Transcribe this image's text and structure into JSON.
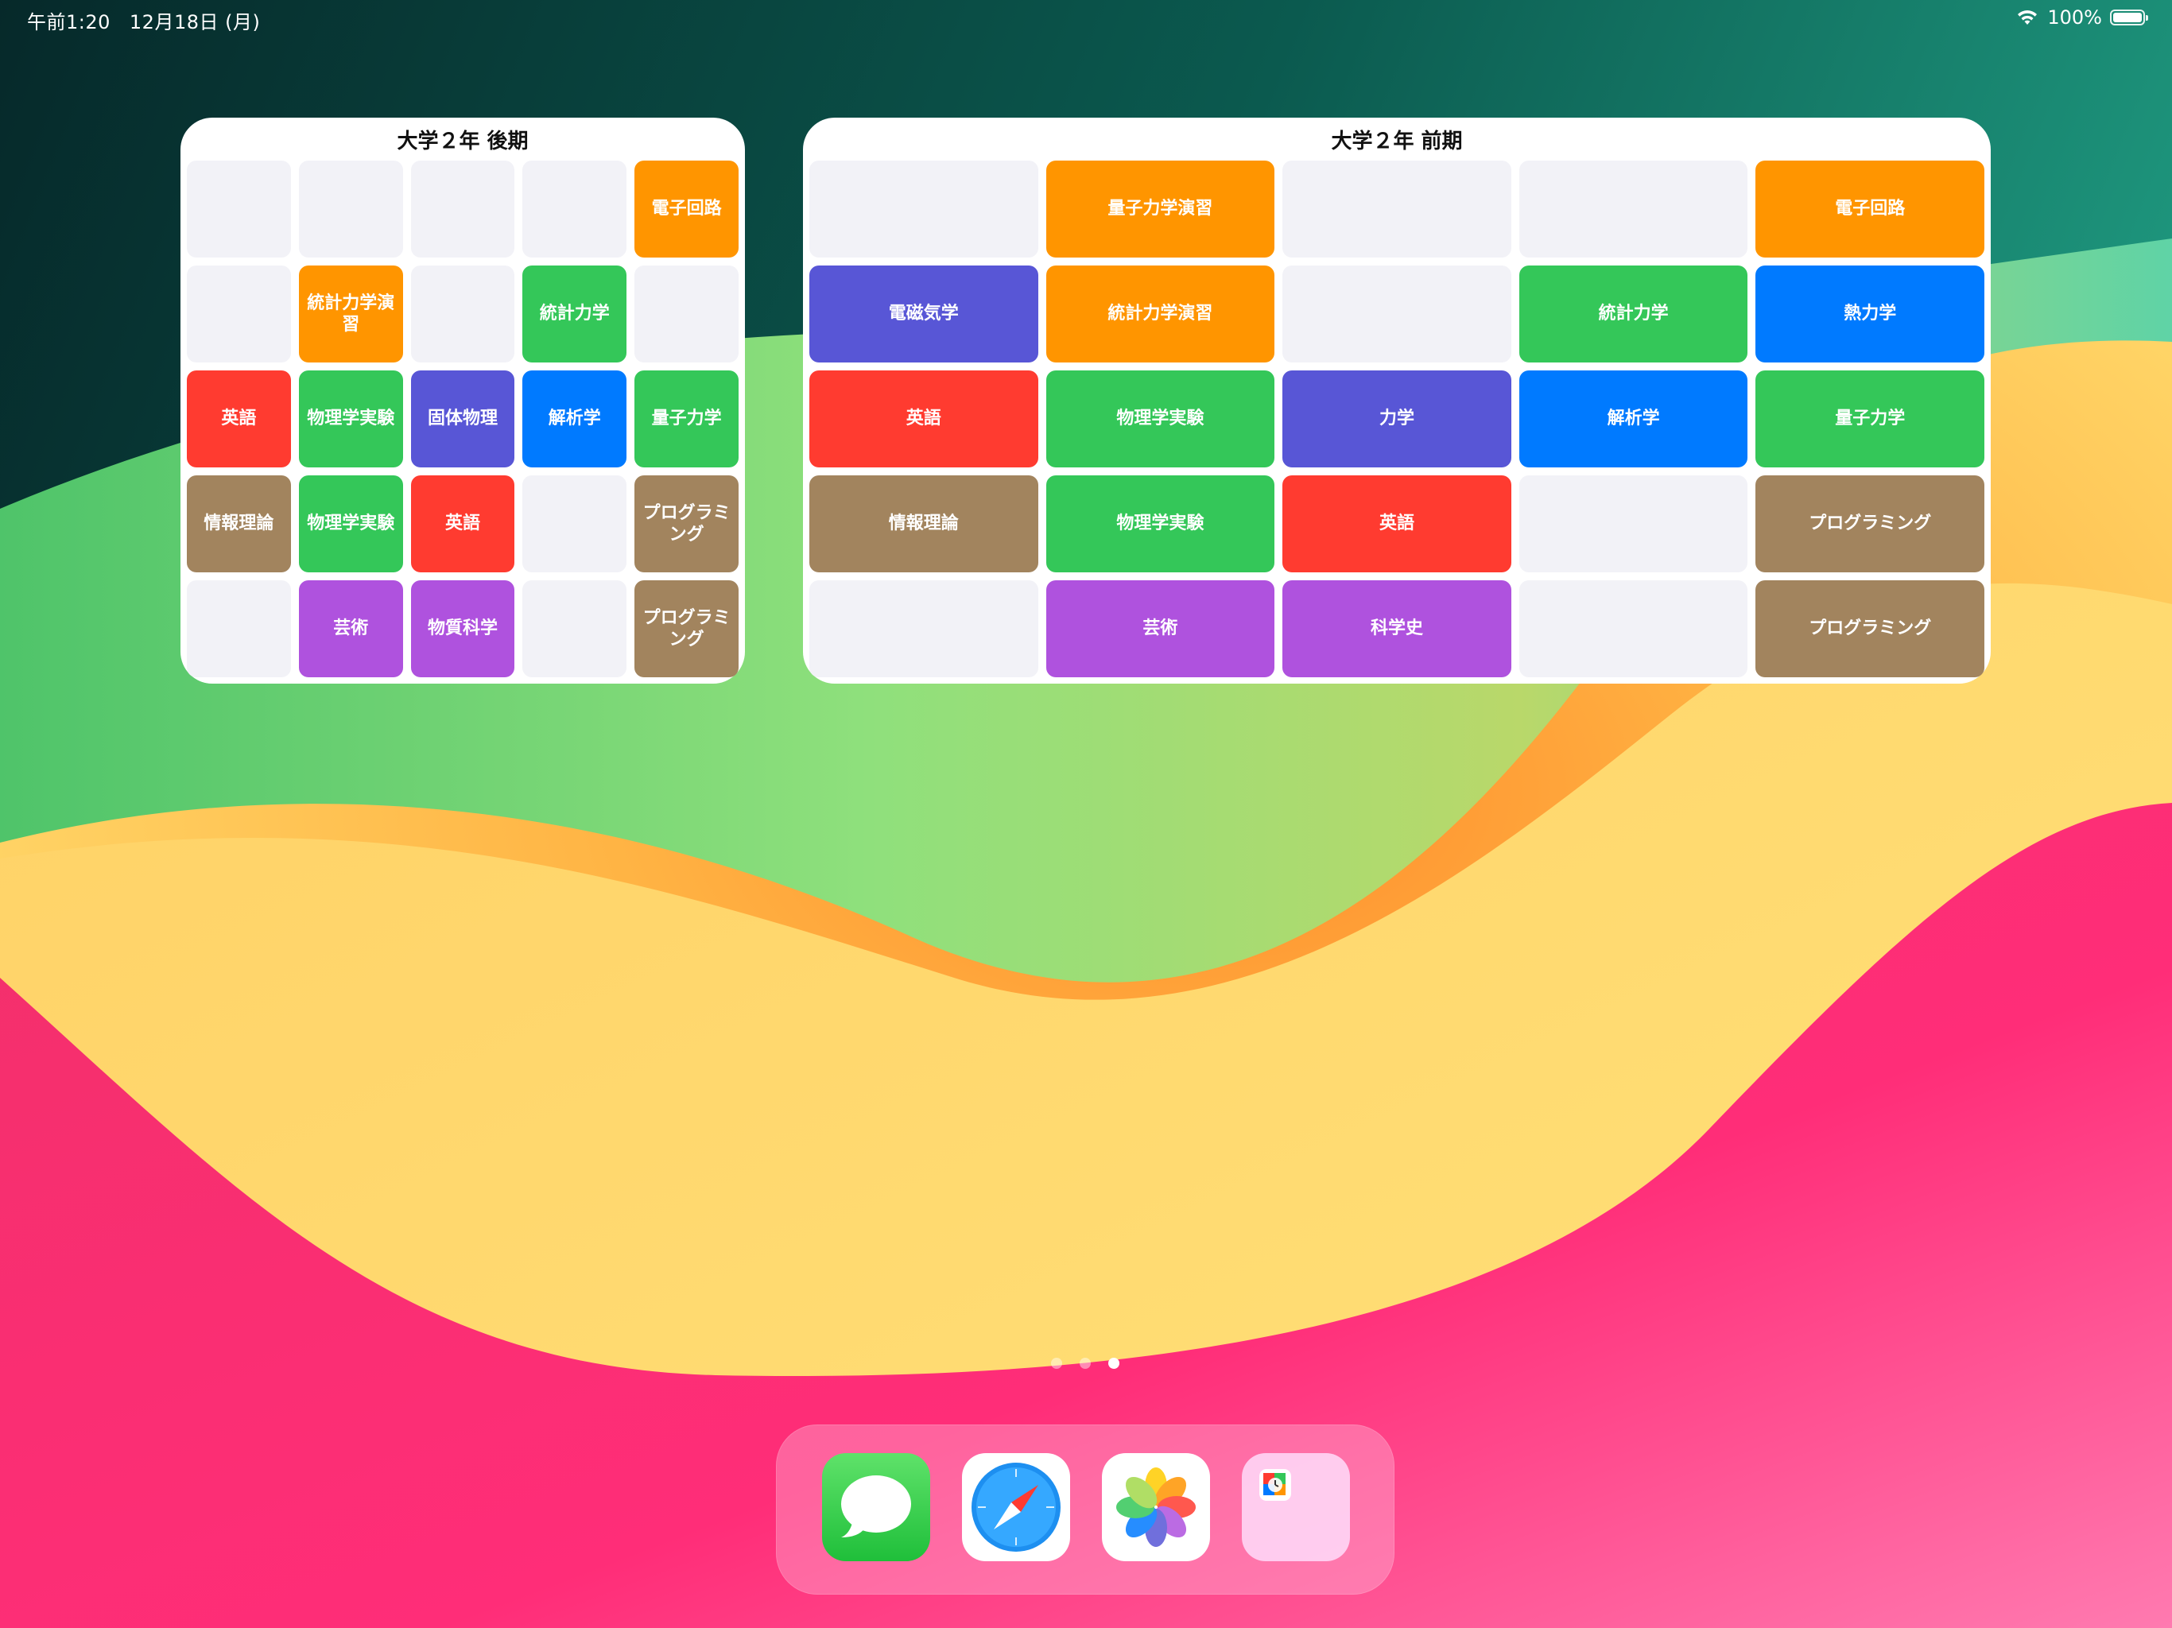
{
  "status_bar": {
    "time": "午前1:20",
    "date": "12月18日 (月)",
    "battery": "100%"
  },
  "colors": {
    "orange": "#ff9500",
    "green": "#34c759",
    "red": "#ff3b30",
    "indigo": "#5856d6",
    "blue": "#007aff",
    "brown": "#a2845e",
    "purple": "#af52de",
    "empty": "#f2f2f7"
  },
  "widget_small": {
    "title": "大学２年 後期",
    "cells": [
      {
        "label": "",
        "color": "empty"
      },
      {
        "label": "",
        "color": "empty"
      },
      {
        "label": "",
        "color": "empty"
      },
      {
        "label": "",
        "color": "empty"
      },
      {
        "label": "電子回路",
        "color": "orange"
      },
      {
        "label": "",
        "color": "empty"
      },
      {
        "label": "統計力学演習",
        "color": "orange"
      },
      {
        "label": "",
        "color": "empty"
      },
      {
        "label": "統計力学",
        "color": "green"
      },
      {
        "label": "",
        "color": "empty"
      },
      {
        "label": "英語",
        "color": "red"
      },
      {
        "label": "物理学実験",
        "color": "green"
      },
      {
        "label": "固体物理",
        "color": "indigo"
      },
      {
        "label": "解析学",
        "color": "blue"
      },
      {
        "label": "量子力学",
        "color": "green"
      },
      {
        "label": "情報理論",
        "color": "brown"
      },
      {
        "label": "物理学実験",
        "color": "green"
      },
      {
        "label": "英語",
        "color": "red"
      },
      {
        "label": "",
        "color": "empty"
      },
      {
        "label": "プログラミング",
        "color": "brown"
      },
      {
        "label": "",
        "color": "empty"
      },
      {
        "label": "芸術",
        "color": "purple"
      },
      {
        "label": "物質科学",
        "color": "purple"
      },
      {
        "label": "",
        "color": "empty"
      },
      {
        "label": "プログラミング",
        "color": "brown"
      }
    ]
  },
  "widget_large": {
    "title": "大学２年 前期",
    "cells": [
      {
        "label": "",
        "color": "empty"
      },
      {
        "label": "量子力学演習",
        "color": "orange"
      },
      {
        "label": "",
        "color": "empty"
      },
      {
        "label": "",
        "color": "empty"
      },
      {
        "label": "電子回路",
        "color": "orange"
      },
      {
        "label": "電磁気学",
        "color": "indigo"
      },
      {
        "label": "統計力学演習",
        "color": "orange"
      },
      {
        "label": "",
        "color": "empty"
      },
      {
        "label": "統計力学",
        "color": "green"
      },
      {
        "label": "熱力学",
        "color": "blue"
      },
      {
        "label": "英語",
        "color": "red"
      },
      {
        "label": "物理学実験",
        "color": "green"
      },
      {
        "label": "力学",
        "color": "indigo"
      },
      {
        "label": "解析学",
        "color": "blue"
      },
      {
        "label": "量子力学",
        "color": "green"
      },
      {
        "label": "情報理論",
        "color": "brown"
      },
      {
        "label": "物理学実験",
        "color": "green"
      },
      {
        "label": "英語",
        "color": "red"
      },
      {
        "label": "",
        "color": "empty"
      },
      {
        "label": "プログラミング",
        "color": "brown"
      },
      {
        "label": "",
        "color": "empty"
      },
      {
        "label": "芸術",
        "color": "purple"
      },
      {
        "label": "科学史",
        "color": "purple"
      },
      {
        "label": "",
        "color": "empty"
      },
      {
        "label": "プログラミング",
        "color": "brown"
      }
    ]
  },
  "page_indicator": {
    "count": 3,
    "active": 3
  },
  "dock": {
    "apps": [
      {
        "icon": "messages-icon"
      },
      {
        "icon": "safari-icon"
      },
      {
        "icon": "photos-icon"
      },
      {
        "icon": "app-folder-icon"
      }
    ]
  }
}
